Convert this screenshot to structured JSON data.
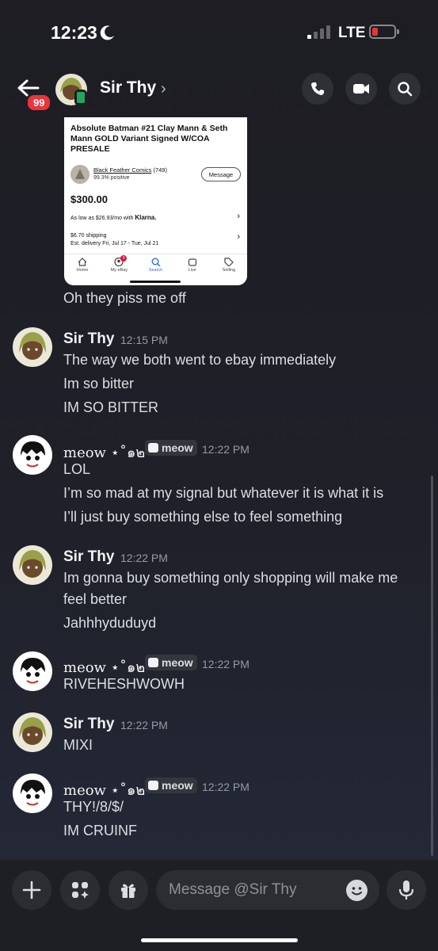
{
  "status_bar": {
    "time": "12:23",
    "network": "LTE"
  },
  "header": {
    "badge": "99",
    "name": "Sir Thy"
  },
  "embed": {
    "title": "Absolute Batman #21 Clay Mann & Seth Mann GOLD Variant Signed W/COA PRESALE",
    "seller": "Black Feather Comics",
    "seller_count": "(749)",
    "positive": "99.3% positive",
    "message_button": "Message",
    "price": "$300.00",
    "klarna_prefix": "As low as $26.93/mo with ",
    "klarna_brand": "Klarna.",
    "shipping": "$6.70 shipping",
    "delivery": "Est. delivery Fri, Jul 17 - Tue, Jul 21",
    "nav": [
      "Home",
      "My eBay",
      "Search",
      "Live",
      "Selling"
    ],
    "nav_badge": "9"
  },
  "messages": {
    "m0": "Oh they piss me off",
    "g1": {
      "user": "Sir Thy",
      "time": "12:15 PM",
      "lines": [
        "The way we both went to ebay immediately",
        "Im so bitter",
        "IM SO BITTER"
      ]
    },
    "g2": {
      "user": "მეოც ⋆˚๑๒",
      "user_display": "meow ⋆˚๑๒",
      "tag": "meow",
      "time": "12:22 PM",
      "lines": [
        "LOL",
        "I’m so mad at my signal but whatever it is what it is",
        "I’ll just buy something else to feel something"
      ]
    },
    "g3": {
      "user": "Sir Thy",
      "time": "12:22 PM",
      "lines": [
        "Im gonna buy something only shopping will make me",
        "feel better",
        "Jahhhyduduyd"
      ]
    },
    "g4": {
      "user_display": "meow ⋆˚๑๒",
      "tag": "meow",
      "time": "12:22 PM",
      "lines": [
        "RIVEHESHWOWH"
      ]
    },
    "g5": {
      "user": "Sir Thy",
      "time": "12:22 PM",
      "lines": [
        "MIXI"
      ]
    },
    "g6": {
      "user_display": "meow ⋆˚๑๒",
      "tag": "meow",
      "time": "12:22 PM",
      "lines": [
        "THY!/8/$/",
        "IM CRUINF"
      ]
    }
  },
  "composer": {
    "placeholder": "Message @Sir Thy"
  }
}
